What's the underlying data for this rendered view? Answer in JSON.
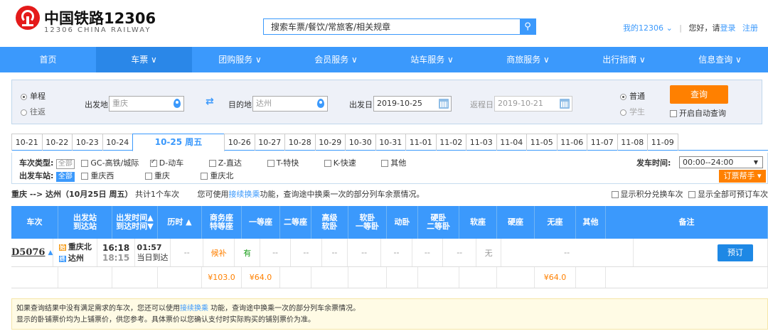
{
  "brand": {
    "cn": "中国铁路12306",
    "en": "12306 CHINA RAILWAY"
  },
  "search": {
    "placeholder": "搜索车票/餐饮/常旅客/相关规章"
  },
  "top_links": {
    "my12306": "我的12306",
    "greeting": "您好，请",
    "login": "登录",
    "register": "注册"
  },
  "nav": [
    "首页",
    "车票 ∨",
    "团购服务 ∨",
    "会员服务 ∨",
    "站车服务 ∨",
    "商旅服务 ∨",
    "出行指南 ∨",
    "信息查询 ∨"
  ],
  "query": {
    "trip_single": "单程",
    "trip_round": "往返",
    "from_label": "出发地",
    "from_value": "重庆",
    "to_label": "目的地",
    "to_value": "达州",
    "date_label": "出发日",
    "date_value": "2019-10-25",
    "return_label": "返程日",
    "return_value": "2019-10-21",
    "type_normal": "普通",
    "type_student": "学生",
    "query_btn": "查询",
    "auto_query": "开启自动查询"
  },
  "dates": [
    "10-21",
    "10-22",
    "10-23",
    "10-24",
    "10-25 周五",
    "10-26",
    "10-27",
    "10-28",
    "10-29",
    "10-30",
    "10-31",
    "11-01",
    "11-02",
    "11-03",
    "11-04",
    "11-05",
    "11-06",
    "11-07",
    "11-08",
    "11-09"
  ],
  "filter": {
    "type_label": "车次类型:",
    "all": "全部",
    "types": [
      "GC-高铁/城际",
      "D-动车",
      "Z-直达",
      "T-特快",
      "K-快速",
      "其他"
    ],
    "station_label": "出发车站:",
    "stations": [
      "重庆西",
      "重庆",
      "重庆北"
    ],
    "time_label": "发车时间:",
    "time_value": "00:00--24:00",
    "helper": "订票帮手"
  },
  "summary": {
    "route": "重庆 --> 达州（10月25日  周五）",
    "count": "共计1个车次",
    "tip_pre": "您可使用",
    "tip_link": "接续换乘",
    "tip_post": "功能，查询途中换乘一次的部分列车余票情况。",
    "opt1": "显示积分兑换车次",
    "opt2": "显示全部可预订车次"
  },
  "table": {
    "headers": [
      [
        "车次"
      ],
      [
        "出发站",
        "到达站"
      ],
      [
        "出发时间▲",
        "到达时间▼"
      ],
      [
        "历时 ▲"
      ],
      [
        "商务座",
        "特等座"
      ],
      [
        "一等座"
      ],
      [
        "二等座"
      ],
      [
        "高级",
        "软卧"
      ],
      [
        "软卧",
        "一等卧"
      ],
      [
        "动卧"
      ],
      [
        "硬卧",
        "二等卧"
      ],
      [
        "软座"
      ],
      [
        "硬座"
      ],
      [
        "无座"
      ],
      [
        "其他"
      ],
      [
        "备注"
      ]
    ],
    "train": {
      "code": "D5076",
      "from_badge": "始",
      "from": "重庆北",
      "to_badge": "终",
      "to": "达州",
      "dep": "16:18",
      "arr": "18:15",
      "dur": "01:57",
      "dur_note": "当日到达"
    },
    "avail": [
      "--",
      "候补",
      "有",
      "--",
      "--",
      "--",
      "--",
      "--",
      "--",
      "--",
      "无",
      "--"
    ],
    "book": "预订",
    "prices": [
      "",
      "",
      "",
      "",
      "¥103.0",
      "¥64.0",
      "",
      "",
      "",
      "",
      "",
      "",
      "",
      "¥64.0",
      "",
      ""
    ]
  },
  "notice": {
    "line1_pre": "如果查询结果中没有满足需求的车次，您还可以使用",
    "line1_link": "接续换乘",
    "line1_post": " 功能，查询途中换乘一次的部分列车余票情况。",
    "line2": "显示的卧铺票价均为上铺票价，供您参考。具体票价以您确认支付时实际购买的铺别票价为准。"
  },
  "colors": {
    "accent": "#3b99fc",
    "orange": "#ff8000",
    "green": "#1b9e1b",
    "brand_red": "#e41a1a"
  }
}
